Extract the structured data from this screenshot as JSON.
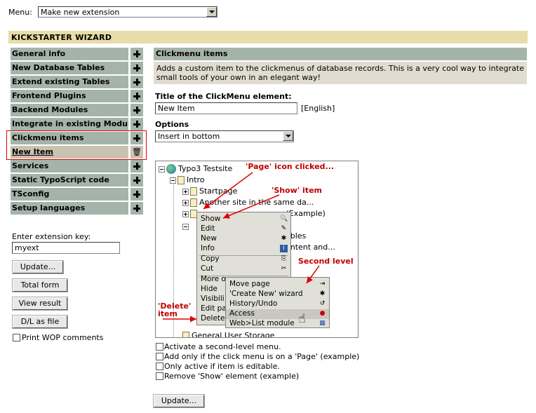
{
  "top": {
    "menu_label": "Menu:",
    "menu_value": "Make new extension"
  },
  "wizard_title": "KICKSTARTER WIZARD",
  "sidebar": {
    "items": [
      {
        "label": "General info"
      },
      {
        "label": "New Database Tables"
      },
      {
        "label": "Extend existing Tables"
      },
      {
        "label": "Frontend Plugins"
      },
      {
        "label": "Backend Modules"
      },
      {
        "label": "Integrate in existing Modules"
      },
      {
        "label": "Clickmenu items"
      },
      {
        "label": "New Item"
      },
      {
        "label": "Services"
      },
      {
        "label": "Static TypoScript code"
      },
      {
        "label": "TSconfig"
      },
      {
        "label": "Setup languages"
      }
    ],
    "ext_key_label": "Enter extension key:",
    "ext_key_value": "myext",
    "buttons": {
      "update": "Update...",
      "total_form": "Total form",
      "view_result": "View result",
      "dl_as_file": "D/L as file"
    },
    "print_wop": "Print WOP comments"
  },
  "panel": {
    "title": "Clickmenu items",
    "description": "Adds a custom item to the clickmenus of database records. This is a very cool way to integrate small tools of your own in an elegant way!",
    "title_field_label": "Title of the ClickMenu element:",
    "title_field_value": "New Item",
    "title_field_lang": "[English]",
    "options_label": "Options",
    "options_value": "Insert in bottom",
    "checkboxes": [
      "Activate a second-level menu.",
      "Add only if the click menu is on a 'Page' (example)",
      "Only active if item is editable.",
      "Remove 'Show' element (example)"
    ],
    "update_button": "Update..."
  },
  "tree": {
    "root": "Typo3 Testsite",
    "intro": "Intro",
    "startpage": "Startpage",
    "another": "Another site in the same da...",
    "example_partial": "(Example)",
    "tables_partial": "ables",
    "content_partial": "ontent and...",
    "storage": "General User Storage"
  },
  "context_menu": {
    "items": [
      "Show",
      "Edit",
      "New",
      "Info",
      "Copy",
      "Cut",
      "More o",
      "Hide",
      "Visibili",
      "Edit pa",
      "Delete"
    ],
    "sub_items": [
      "Move page",
      "'Create New' wizard",
      "History/Undo",
      "Access",
      "Web>List module"
    ]
  },
  "annotations": {
    "page_clicked": "'Page' icon clicked...",
    "show_item": "'Show' item",
    "second_level": "Second level",
    "delete_item_1": "'Delete'",
    "delete_item_2": "item"
  }
}
